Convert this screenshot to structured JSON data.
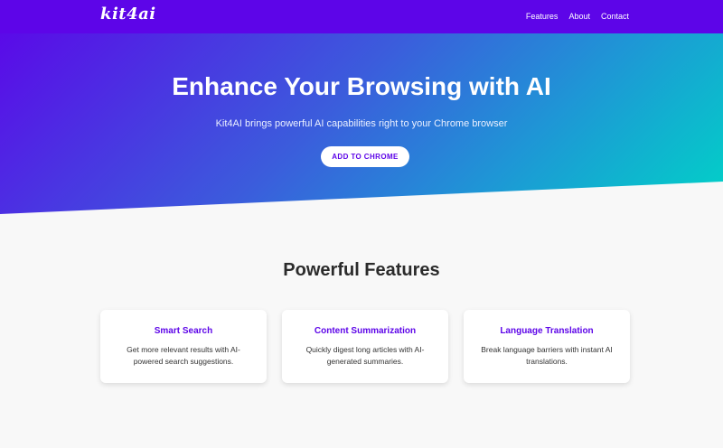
{
  "navbar": {
    "logo": "kit4ai",
    "links": [
      "Features",
      "About",
      "Contact"
    ]
  },
  "hero": {
    "title": "Enhance Your Browsing with AI",
    "subtitle": "Kit4AI brings powerful AI capabilities right to your Chrome browser",
    "cta_label": "ADD TO CHROME"
  },
  "features": {
    "title": "Powerful Features",
    "cards": [
      {
        "title": "Smart Search",
        "description": "Get more relevant results with AI-powered search suggestions."
      },
      {
        "title": "Content Summarization",
        "description": "Quickly digest long articles with AI-generated summaries."
      },
      {
        "title": "Language Translation",
        "description": "Break language barriers with instant AI translations."
      }
    ]
  },
  "colors": {
    "brand": "#5d05e8",
    "gradient_start": "#5a0ae8",
    "gradient_end": "#00d3c7",
    "background": "#f8f8f8"
  }
}
